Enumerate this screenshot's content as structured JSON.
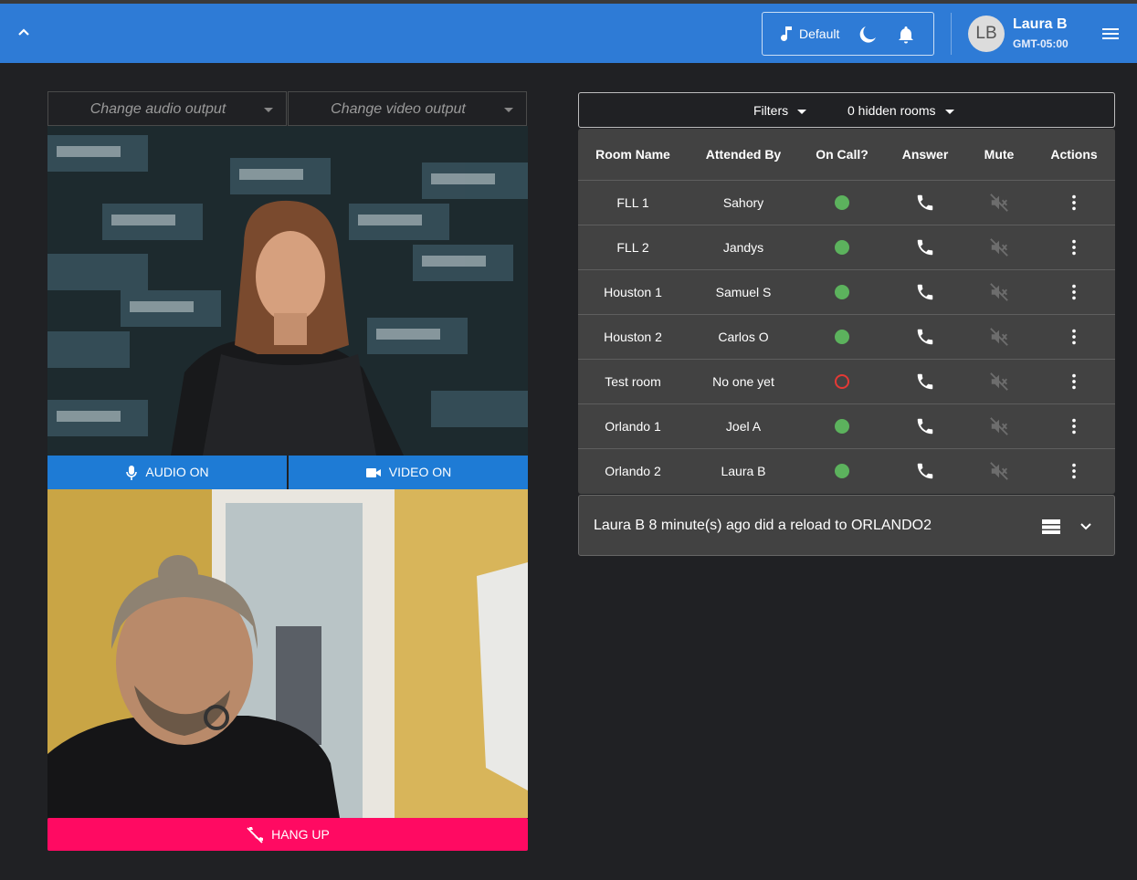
{
  "header": {
    "mode_label": "Default",
    "user_initials": "LB",
    "user_name": "Laura B",
    "user_timezone": "GMT-05:00",
    "color": "#2e7bd6"
  },
  "outputs": {
    "audio_placeholder": "Change audio output",
    "video_placeholder": "Change video output"
  },
  "media": {
    "audio_label": "AUDIO ON",
    "video_label": "VIDEO ON",
    "hangup_label": "HANG UP",
    "button_color": "#1e7bd5",
    "hangup_color": "#ff0a62"
  },
  "filters": {
    "filters_label": "Filters",
    "hidden_rooms_label": "0 hidden rooms"
  },
  "rooms": {
    "columns": [
      "Room Name",
      "Attended By",
      "On Call?",
      "Answer",
      "Mute",
      "Actions"
    ],
    "rows": [
      {
        "room": "FLL 1",
        "attended_by": "Sahory",
        "on_call": true
      },
      {
        "room": "FLL 2",
        "attended_by": "Jandys",
        "on_call": true
      },
      {
        "room": "Houston 1",
        "attended_by": "Samuel S",
        "on_call": true
      },
      {
        "room": "Houston 2",
        "attended_by": "Carlos O",
        "on_call": true
      },
      {
        "room": "Test room",
        "attended_by": "No one yet",
        "on_call": false
      },
      {
        "room": "Orlando 1",
        "attended_by": "Joel A",
        "on_call": true
      },
      {
        "room": "Orlando 2",
        "attended_by": "Laura B",
        "on_call": true
      }
    ]
  },
  "log": {
    "message": "Laura B 8 minute(s) ago did a reload to ORLANDO2"
  },
  "icons": {
    "collapse": "chevron-up-icon",
    "mode": "music-note-icon",
    "theme": "moon-icon",
    "notifications": "bell-icon",
    "menu": "hamburger-menu-icon",
    "answer": "phone-icon",
    "mute": "volume-off-icon",
    "actions": "more-vert-icon",
    "log_list": "view-list-icon",
    "log_expand": "chevron-down-icon"
  }
}
